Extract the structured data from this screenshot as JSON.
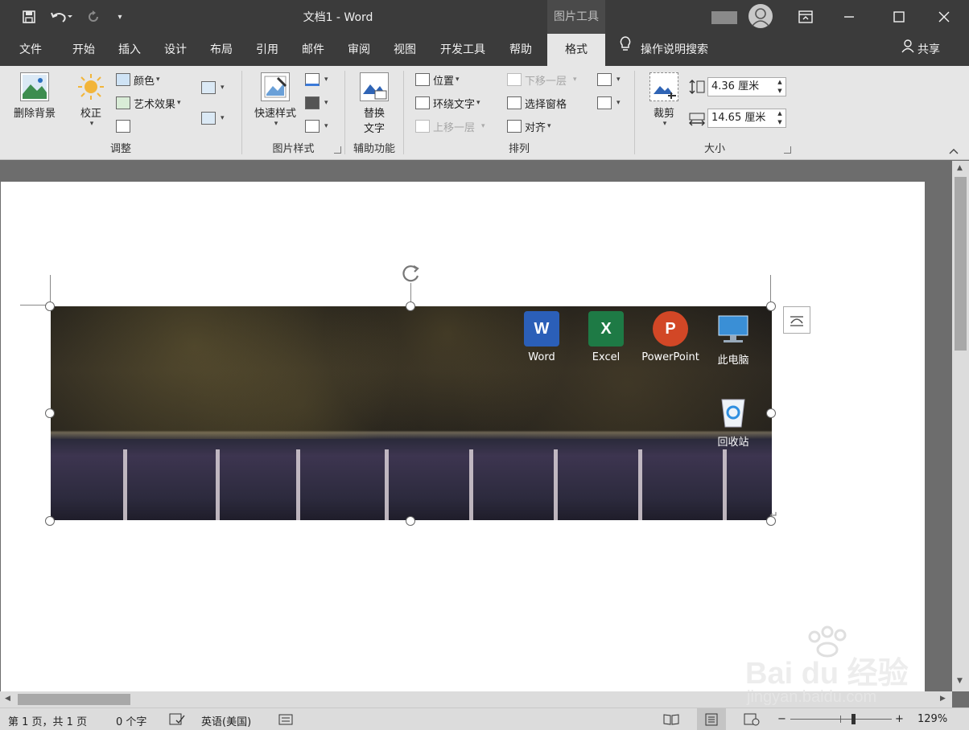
{
  "window": {
    "title": "文档1  -  Word",
    "picture_tools": "图片工具"
  },
  "tabs": [
    {
      "label": "文件"
    },
    {
      "label": "开始"
    },
    {
      "label": "插入"
    },
    {
      "label": "设计"
    },
    {
      "label": "布局"
    },
    {
      "label": "引用"
    },
    {
      "label": "邮件"
    },
    {
      "label": "审阅"
    },
    {
      "label": "视图"
    },
    {
      "label": "开发工具"
    },
    {
      "label": "帮助"
    },
    {
      "label": "格式"
    }
  ],
  "search_label": "操作说明搜索",
  "share_label": "共享",
  "ribbon": {
    "adjust": {
      "remove_bg": "删除背景",
      "corrections": "校正",
      "color": "颜色",
      "artistic": "艺术效果",
      "label": "调整"
    },
    "styles": {
      "quick_styles": "快速样式",
      "label": "图片样式"
    },
    "accessibility": {
      "alt_text_1": "替换",
      "alt_text_2": "文字",
      "label": "辅助功能"
    },
    "arrange": {
      "position": "位置",
      "wrap_text": "环绕文字",
      "bring_forward": "上移一层",
      "send_backward": "下移一层",
      "selection_pane": "选择窗格",
      "align": "对齐",
      "label": "排列"
    },
    "size": {
      "crop": "裁剪",
      "height": "4.36 厘米",
      "width": "14.65 厘米",
      "label": "大小"
    }
  },
  "desktop_icons": [
    {
      "label": "Word",
      "letter": "W",
      "color": "#2b5fb8"
    },
    {
      "label": "Excel",
      "letter": "X",
      "color": "#1e7a45"
    },
    {
      "label": "PowerPoint",
      "letter": "P",
      "color": "#d24726"
    },
    {
      "label": "此电脑",
      "letter": "",
      "color": "#3a8fd6"
    },
    {
      "label": "回收站",
      "letter": "",
      "color": "#dfe6ee"
    }
  ],
  "status": {
    "page": "第 1 页，共 1 页",
    "words": "0 个字",
    "language": "英语(美国)",
    "zoom": "129%",
    "zoom_level": 0.62
  },
  "watermark": {
    "brand": "Bai du 经验",
    "url": "jingyan.baidu.com"
  }
}
